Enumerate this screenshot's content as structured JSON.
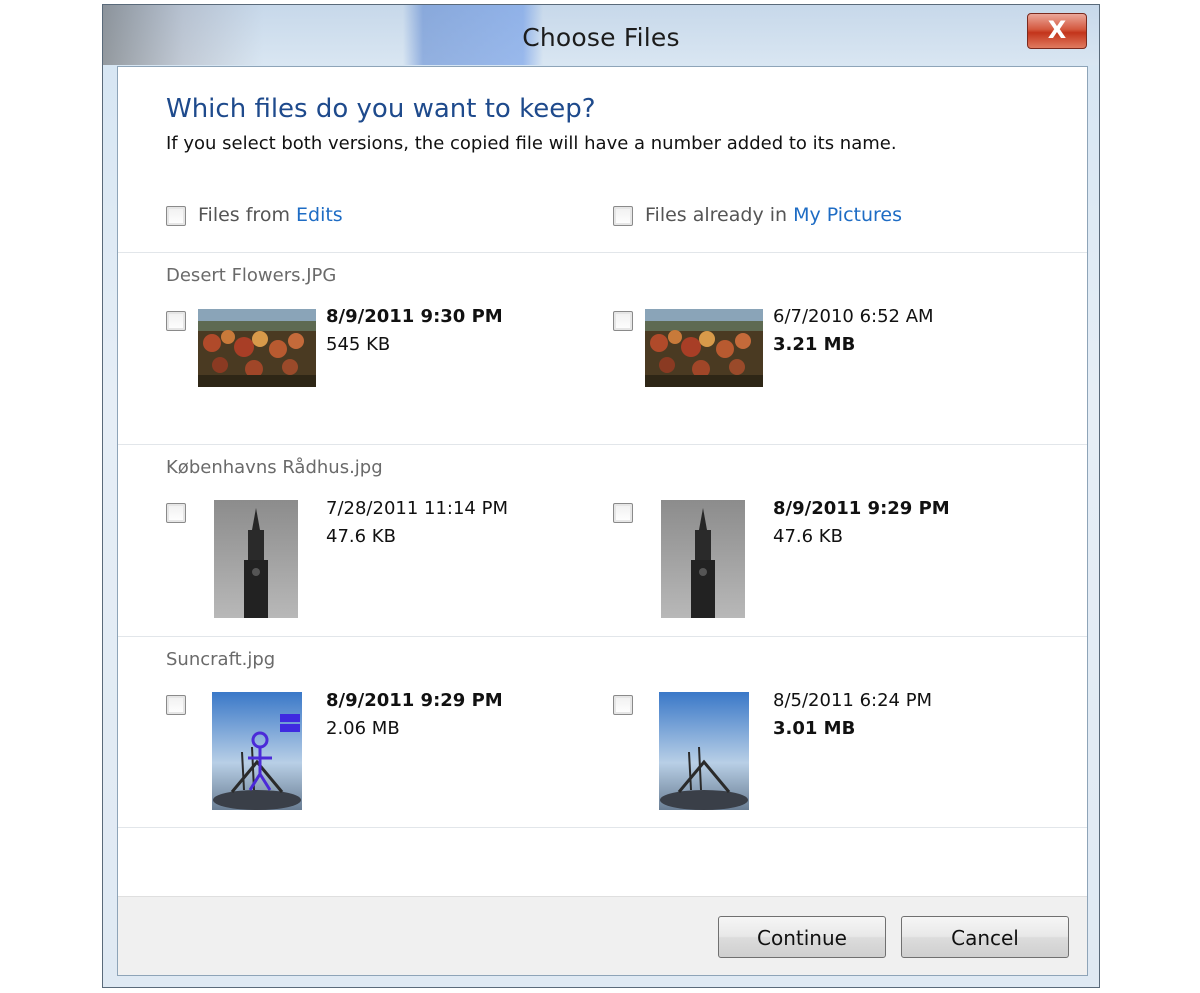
{
  "window": {
    "title": "Choose Files",
    "close_label": "X"
  },
  "dialog": {
    "heading": "Which files do you want to keep?",
    "subheading": "If you select both versions, the copied file will have a number added to its name.",
    "select_all_source": {
      "prefix": "Files from ",
      "link": "Edits"
    },
    "select_all_dest": {
      "prefix": "Files already in ",
      "link": "My Pictures"
    }
  },
  "files": [
    {
      "name": "Desert Flowers.JPG",
      "source": {
        "date": "8/9/2011 9:30 PM",
        "size": "545 KB",
        "bold_date": true,
        "bold_size": false
      },
      "dest": {
        "date": "6/7/2010 6:52 AM",
        "size": "3.21 MB",
        "bold_date": false,
        "bold_size": true
      }
    },
    {
      "name": "Københavns Rådhus.jpg",
      "source": {
        "date": "7/28/2011 11:14 PM",
        "size": "47.6 KB",
        "bold_date": false,
        "bold_size": false
      },
      "dest": {
        "date": "8/9/2011 9:29 PM",
        "size": "47.6 KB",
        "bold_date": true,
        "bold_size": false
      }
    },
    {
      "name": "Suncraft.jpg",
      "source": {
        "date": "8/9/2011 9:29 PM",
        "size": "2.06 MB",
        "bold_date": true,
        "bold_size": false
      },
      "dest": {
        "date": "8/5/2011 6:24 PM",
        "size": "3.01 MB",
        "bold_date": false,
        "bold_size": true
      }
    }
  ],
  "buttons": {
    "continue": "Continue",
    "cancel": "Cancel"
  }
}
